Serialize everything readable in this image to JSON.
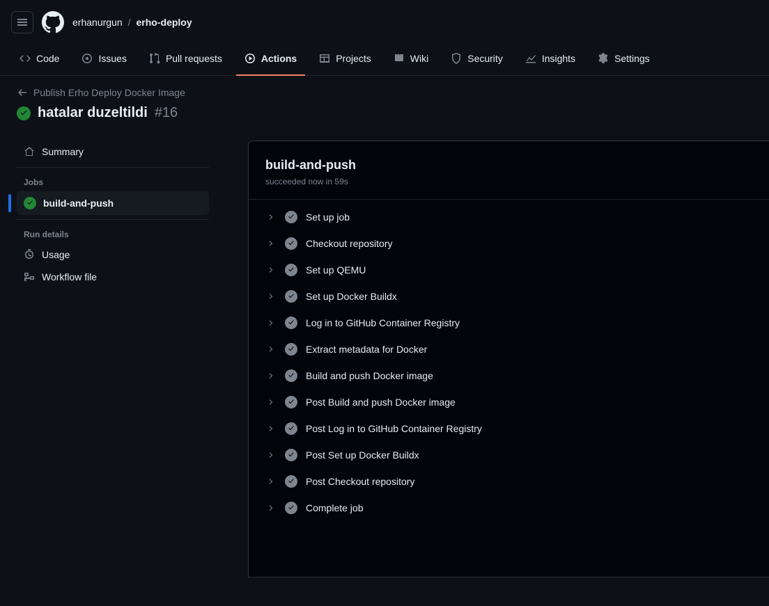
{
  "header": {
    "owner": "erhanurgun",
    "separator": "/",
    "repo": "erho-deploy"
  },
  "nav": {
    "code": "Code",
    "issues": "Issues",
    "pulls": "Pull requests",
    "actions": "Actions",
    "projects": "Projects",
    "wiki": "Wiki",
    "security": "Security",
    "insights": "Insights",
    "settings": "Settings"
  },
  "run": {
    "back_label": "Publish Erho Deploy Docker Image",
    "title": "hatalar duzeltildi",
    "number": "#16"
  },
  "sidebar": {
    "summary": "Summary",
    "jobs_heading": "Jobs",
    "job_name": "build-and-push",
    "details_heading": "Run details",
    "usage": "Usage",
    "workflow_file": "Workflow file"
  },
  "job": {
    "title": "build-and-push",
    "subtitle": "succeeded now in 59s",
    "steps": [
      "Set up job",
      "Checkout repository",
      "Set up QEMU",
      "Set up Docker Buildx",
      "Log in to GitHub Container Registry",
      "Extract metadata for Docker",
      "Build and push Docker image",
      "Post Build and push Docker image",
      "Post Log in to GitHub Container Registry",
      "Post Set up Docker Buildx",
      "Post Checkout repository",
      "Complete job"
    ]
  }
}
